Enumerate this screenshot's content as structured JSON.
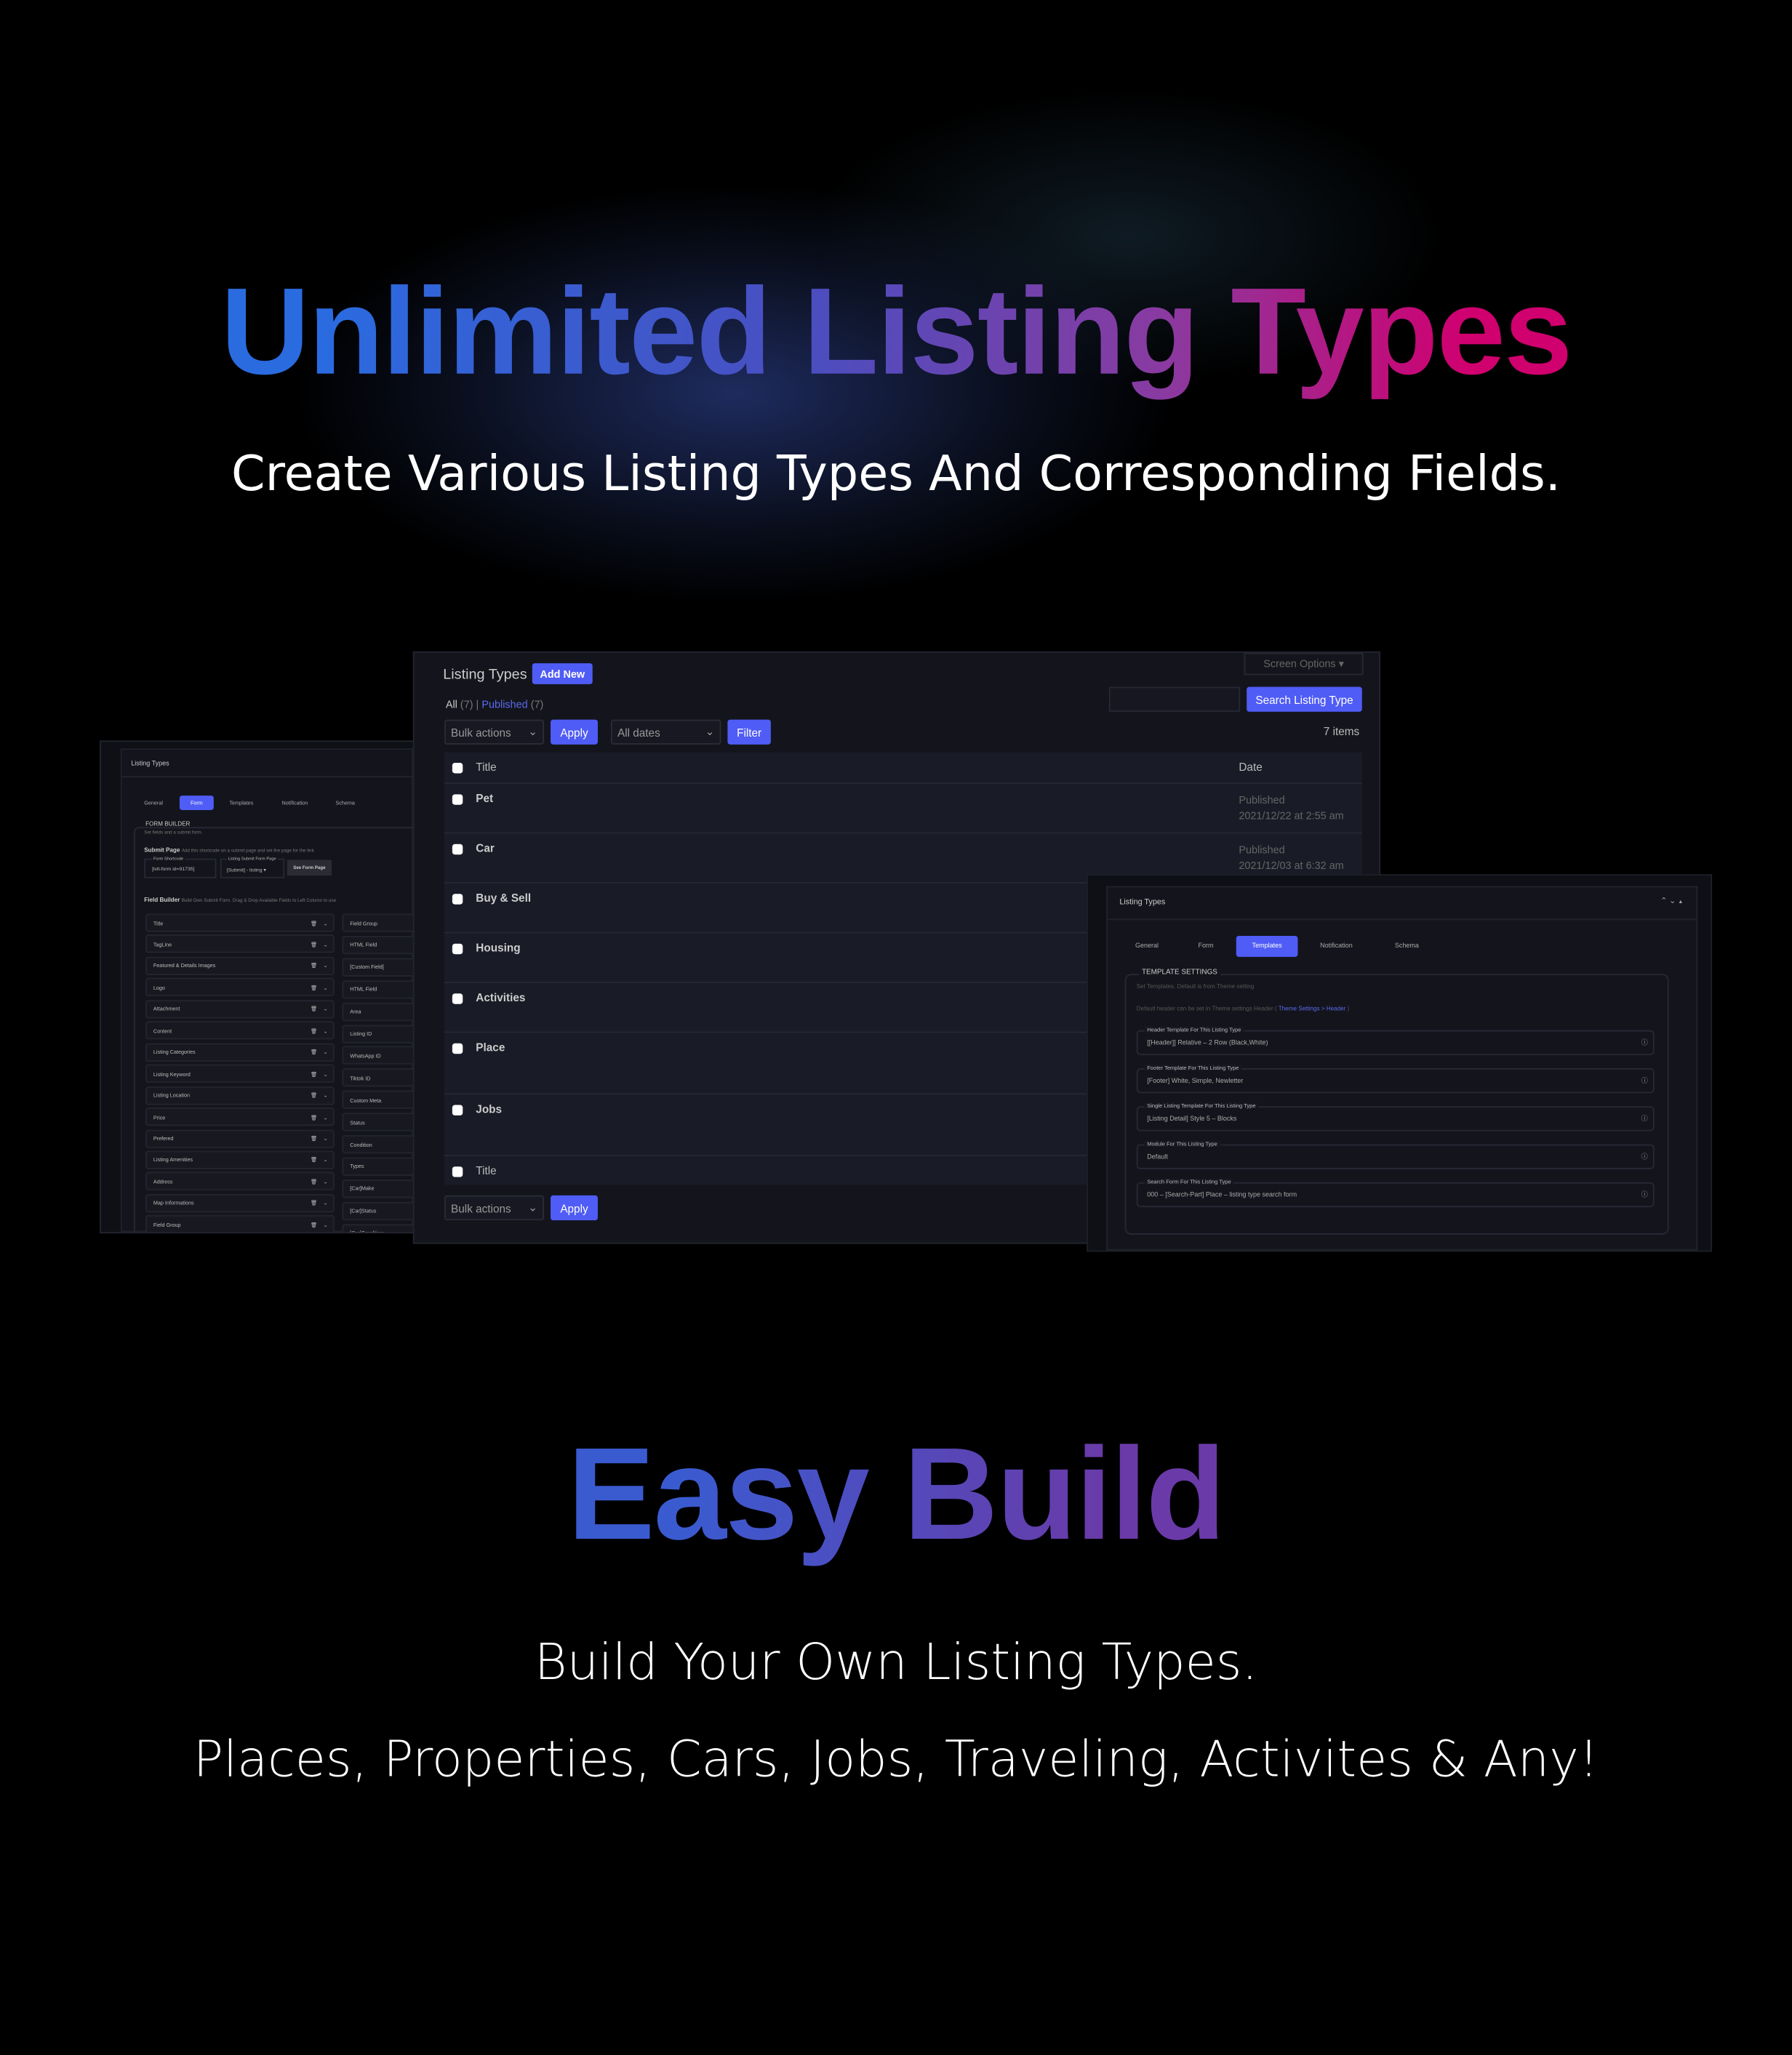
{
  "hero": {
    "title": "Unlimited Listing Types",
    "subtitle": "Create Various Listing Types And Corresponding Fields.",
    "gradient": [
      "#2a6be0",
      "#d0006f"
    ]
  },
  "footer": {
    "title": "Easy Build",
    "line1": "Build Your Own Listing Types.",
    "line2": "Places, Properties, Cars, Jobs, Traveling, Activites & Any!",
    "gradient": [
      "#3a5bd0",
      "#6a3aa8"
    ]
  },
  "accent": "#4f5cf5",
  "list_panel": {
    "title": "Listing Types",
    "add_new": "Add New",
    "screen_options": "Screen Options ▾",
    "filter_all": "All",
    "filter_all_count": "(7)",
    "sep": "|",
    "filter_published": "Published",
    "filter_published_count": "(7)",
    "search_placeholder": "",
    "search_button": "Search Listing Type",
    "bulk_actions": "Bulk actions",
    "apply": "Apply",
    "all_dates": "All dates",
    "filter": "Filter",
    "items_count": "7 items",
    "col_title": "Title",
    "col_date": "Date",
    "rows": [
      {
        "title": "Pet",
        "status": "Published",
        "date": "2021/12/22 at 2:55 am"
      },
      {
        "title": "Car",
        "status": "Published",
        "date": "2021/12/03 at 6:32 am"
      },
      {
        "title": "Buy & Sell"
      },
      {
        "title": "Housing"
      },
      {
        "title": "Activities"
      },
      {
        "title": "Place"
      },
      {
        "title": "Jobs"
      }
    ],
    "footer_col_title": "Title",
    "bulk_actions_bottom": "Bulk actions",
    "apply_bottom": "Apply"
  },
  "form_panel": {
    "title": "Listing Types",
    "tabs": [
      "General",
      "Form",
      "Templates",
      "Notification",
      "Schema"
    ],
    "active_tab": "Form",
    "section": "FORM BUILDER",
    "section_desc": "Set fields and a submit form.",
    "submit_page": "Submit Page",
    "submit_desc": "Add this shortcode on a submit page and set the page for the link",
    "shortcode_label": "Form Shortcode",
    "shortcode_value": "[lvlt-form id=91735]",
    "page_label": "Listing Submit Form Page",
    "page_value": "[Submit] - listing ▾",
    "see_button": "See Form Page",
    "field_builder": "Field Builder",
    "field_builder_desc": "Build Own Submit Form. Drag & Drop Available Fields to Left Column to use",
    "used_fields": [
      "Title",
      "TagLine",
      "Featured & Details Images",
      "Logo",
      "Attachment",
      "Content",
      "Listing Categories",
      "Listing Keyword",
      "Listing Location",
      "Price",
      "Prefered",
      "Listing Amenities",
      "Address",
      "Map Informations",
      "Field Group"
    ],
    "available_fields": [
      "Field Group",
      "HTML Field",
      "[Custom Field]",
      "HTML Field",
      "Area",
      "Listing ID",
      "WhatsApp ID",
      "Tiktok ID",
      "Custom Meta",
      "Status",
      "Condition",
      "Types",
      "[Car]Make",
      "[Car]Status",
      "[Car]Condition"
    ]
  },
  "templates_panel": {
    "title": "Listing Types",
    "tabs": [
      "General",
      "Form",
      "Templates",
      "Notification",
      "Schema"
    ],
    "active_tab": "Templates",
    "section": "TEMPLATE SETTINGS",
    "section_desc": "Set Templates. Default is from Theme setting",
    "note": "Default header can be set in Theme settings Header (",
    "note_link": "Theme Settings > Header",
    "note_end": ")",
    "fields": [
      {
        "label": "Header Template For This Listing Type",
        "value": "[[Header]] Relative – 2 Row (Black,White)"
      },
      {
        "label": "Footer Template For This Listing Type",
        "value": "[Footer] White, Simple, Newletter"
      },
      {
        "label": "Single Listing Template For This Listing Type",
        "value": "[Listing Detail] Style 5 – Blocks"
      },
      {
        "label": "Module For This Listing Type",
        "value": "Default"
      },
      {
        "label": "Search Form For This Listing Type",
        "value": "000 – [Search-Part] Place – listing type search form"
      }
    ]
  }
}
